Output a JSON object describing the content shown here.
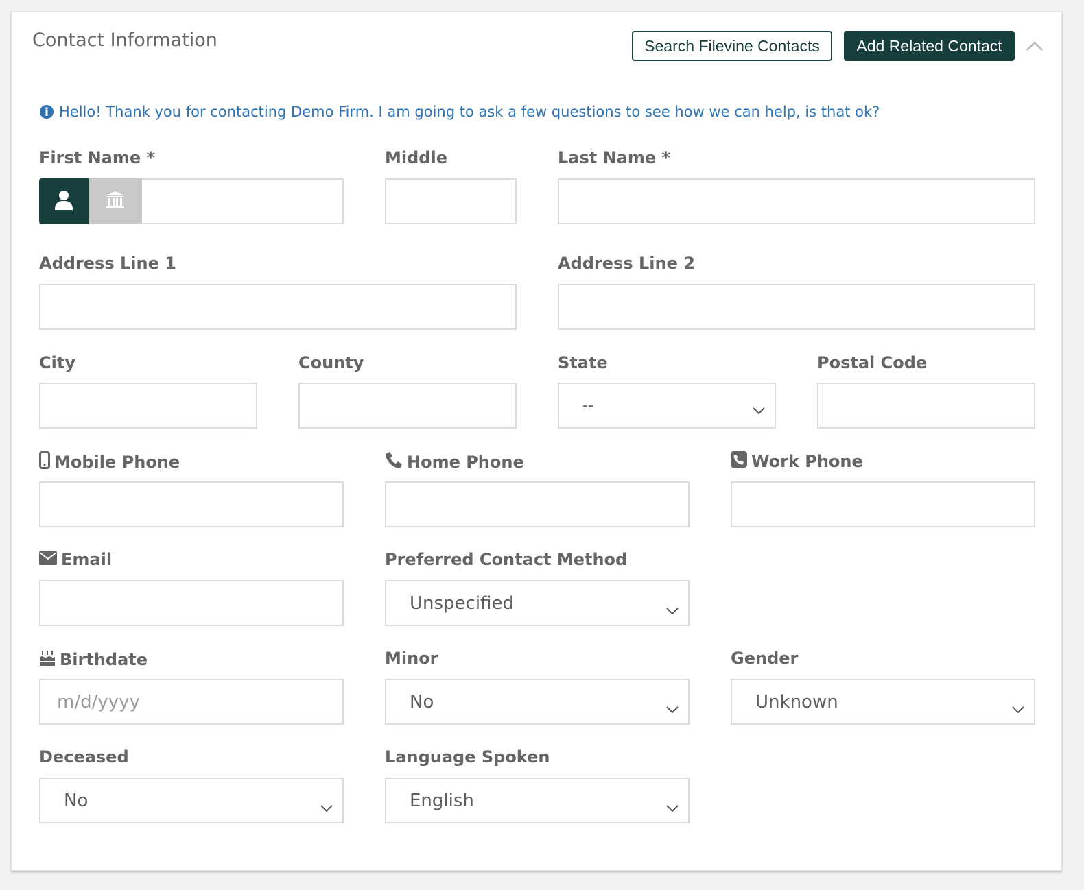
{
  "card": {
    "title": "Contact Information",
    "search_button": "Search Filevine Contacts",
    "add_button": "Add Related Contact",
    "info_message": "Hello! Thank you for contacting Demo Firm. I am going to ask a few questions to see how we can help, is that ok?"
  },
  "fields": {
    "first_name": {
      "label": "First Name *",
      "value": ""
    },
    "middle": {
      "label": "Middle",
      "value": ""
    },
    "last_name": {
      "label": "Last Name *",
      "value": ""
    },
    "address1": {
      "label": "Address Line 1",
      "value": ""
    },
    "address2": {
      "label": "Address Line 2",
      "value": ""
    },
    "city": {
      "label": "City",
      "value": ""
    },
    "county": {
      "label": "County",
      "value": ""
    },
    "state": {
      "label": "State",
      "value": "--"
    },
    "postal": {
      "label": "Postal Code",
      "value": ""
    },
    "mobile": {
      "label": "Mobile Phone",
      "value": ""
    },
    "home": {
      "label": "Home Phone",
      "value": ""
    },
    "work": {
      "label": "Work Phone",
      "value": ""
    },
    "email": {
      "label": "Email",
      "value": ""
    },
    "preferred": {
      "label": "Preferred Contact Method",
      "value": "Unspecified"
    },
    "birthdate": {
      "label": "Birthdate",
      "value": "",
      "placeholder": "m/d/yyyy"
    },
    "minor": {
      "label": "Minor",
      "value": "No"
    },
    "gender": {
      "label": "Gender",
      "value": "Unknown"
    },
    "deceased": {
      "label": "Deceased",
      "value": "No"
    },
    "language": {
      "label": "Language Spoken",
      "value": "English"
    }
  },
  "icons": {
    "info": "info-circle-icon",
    "person": "user-icon",
    "org": "institution-icon",
    "mobile": "mobile-phone-icon",
    "home": "phone-icon",
    "work": "phone-square-icon",
    "email": "envelope-icon",
    "birthdate": "birthday-cake-icon",
    "collapse": "chevron-up-icon",
    "dropdown": "chevron-down-icon"
  },
  "colors": {
    "brand_dark": "#173f3e",
    "info_text": "#2f73b0",
    "label_text": "#656565",
    "border": "#dcdcdc",
    "toggle_inactive": "#c9c9c9"
  }
}
